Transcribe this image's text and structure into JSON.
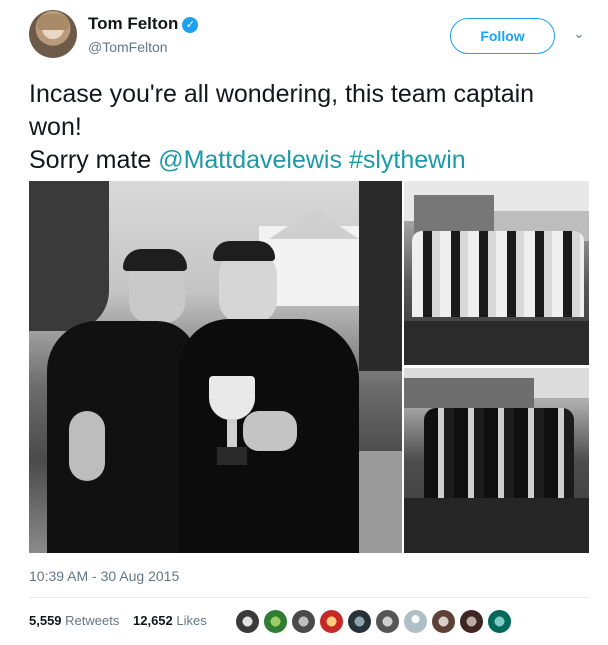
{
  "author": {
    "name": "Tom Felton",
    "handle": "@TomFelton",
    "verified_icon": "verified-badge-icon",
    "avatar_icon": "user-avatar"
  },
  "follow_label": "Follow",
  "menu_icon": "chevron-down-icon",
  "text": {
    "line1": "Incase you're all wondering, this team captain",
    "line2": "won!",
    "line3_prefix": "Sorry mate ",
    "mention": "@Mattdavelewis",
    "hashtag": "#slythewin"
  },
  "media": {
    "count": 3,
    "images": [
      "photo-two-men-with-trophy",
      "photo-team-group-outdoor",
      "photo-team-group-with-trophy"
    ]
  },
  "timestamp": "10:39 AM - 30 Aug 2015",
  "stats": {
    "retweets_count": "5,559",
    "retweets_label": "Retweets",
    "likes_count": "12,652",
    "likes_label": "Likes"
  },
  "likers_count": 10,
  "colors": {
    "link": "#1c9aa8",
    "follow": "#1da1f2",
    "muted": "#657786",
    "text": "#14171a"
  }
}
